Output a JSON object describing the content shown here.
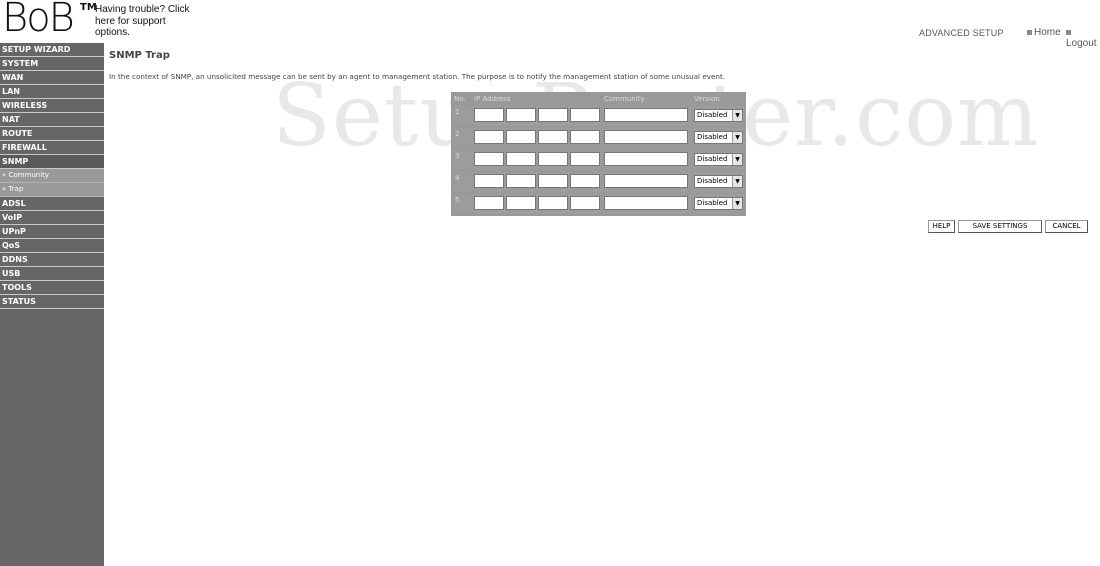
{
  "header": {
    "logo": "BoB",
    "tm": "TM",
    "support_link": "Having trouble? Click here for support options.",
    "section": "ADVANCED SETUP",
    "home": "Home",
    "logout": "Logout"
  },
  "sidebar": {
    "items": [
      {
        "label": "SETUP WIZARD"
      },
      {
        "label": "SYSTEM"
      },
      {
        "label": "WAN"
      },
      {
        "label": "LAN"
      },
      {
        "label": "WIRELESS"
      },
      {
        "label": "NAT"
      },
      {
        "label": "ROUTE"
      },
      {
        "label": "FIREWALL"
      },
      {
        "label": "SNMP"
      }
    ],
    "subitems": [
      {
        "label": "» Community"
      },
      {
        "label": "» Trap"
      }
    ],
    "items_after": [
      {
        "label": "ADSL"
      },
      {
        "label": "VoIP"
      },
      {
        "label": "UPnP"
      },
      {
        "label": "QoS"
      },
      {
        "label": "DDNS"
      },
      {
        "label": "USB"
      },
      {
        "label": "TOOLS"
      },
      {
        "label": "STATUS"
      }
    ]
  },
  "main": {
    "title": "SNMP Trap",
    "description": "In the context of SNMP, an unsolicited message can be sent by an agent to management station. The purpose is to notify the management station of some unusual event.",
    "watermark": "SetupRouter.com"
  },
  "table": {
    "headers": {
      "no": "No.",
      "ip": "IP Address",
      "community": "Community",
      "version": "Version"
    },
    "rows": [
      {
        "no": "1",
        "version": "Disabled"
      },
      {
        "no": "2",
        "version": "Disabled"
      },
      {
        "no": "3",
        "version": "Disabled"
      },
      {
        "no": "4",
        "version": "Disabled"
      },
      {
        "no": "5",
        "version": "Disabled"
      }
    ]
  },
  "buttons": {
    "help": "HELP",
    "save": "SAVE SETTINGS",
    "cancel": "CANCEL"
  }
}
